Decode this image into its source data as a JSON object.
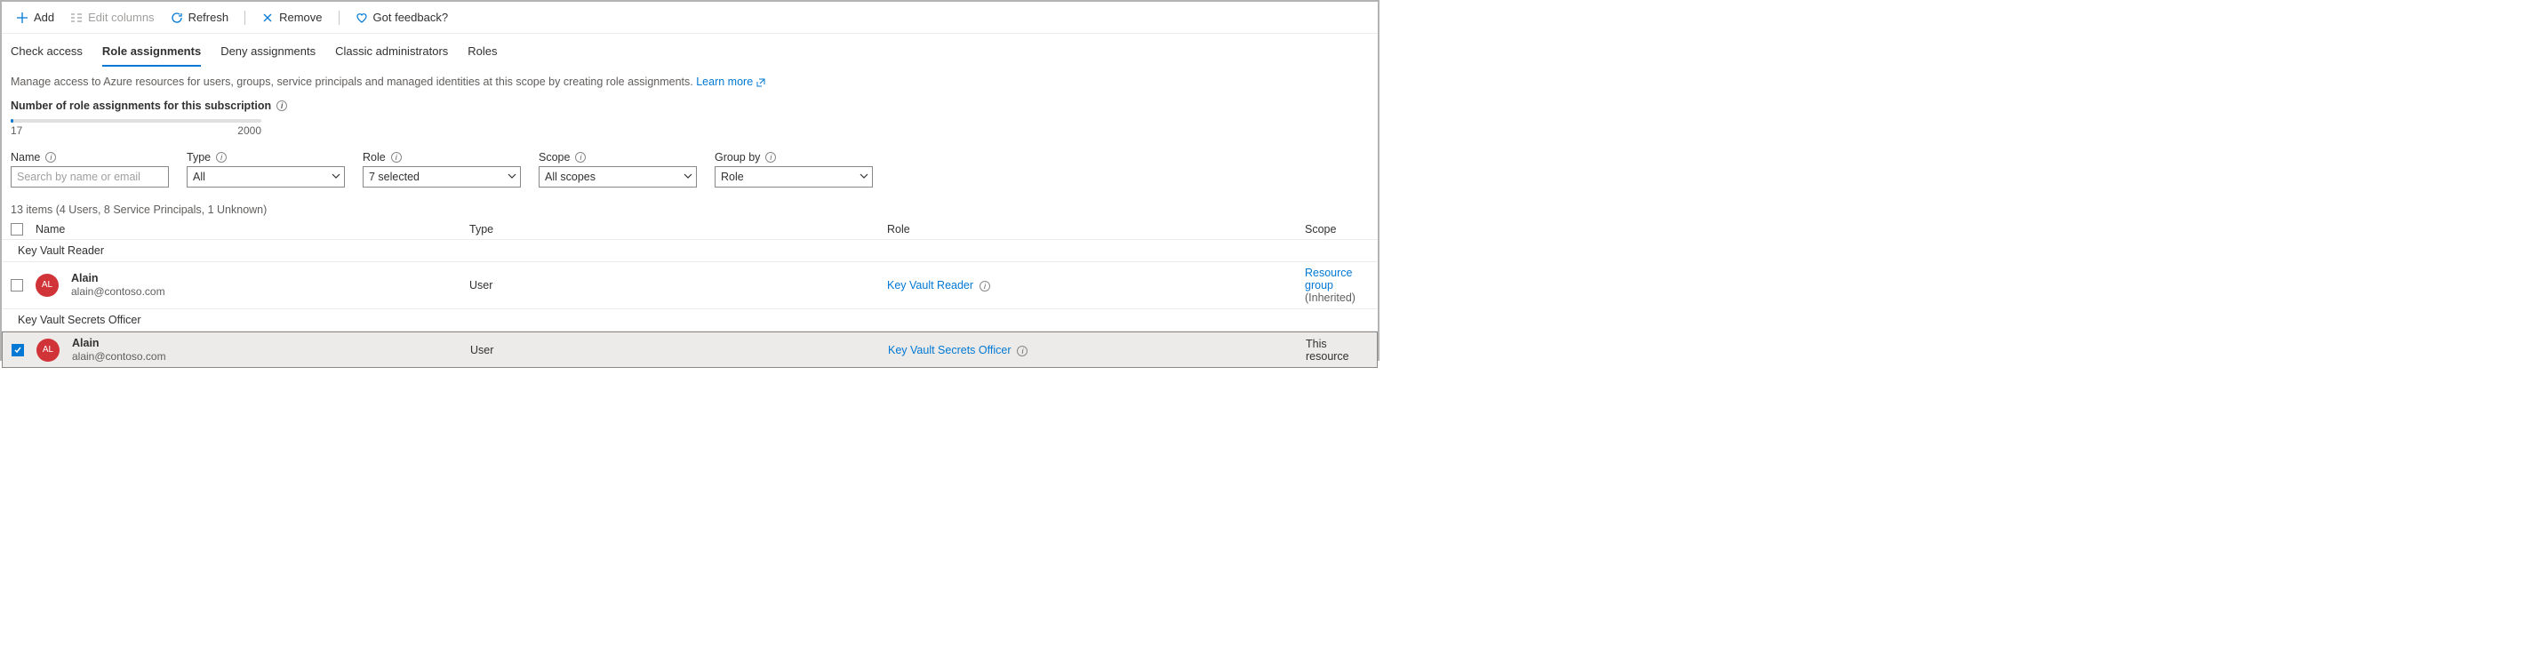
{
  "toolbar": {
    "add": "Add",
    "edit_columns": "Edit columns",
    "refresh": "Refresh",
    "remove": "Remove",
    "feedback": "Got feedback?"
  },
  "tabs": {
    "check_access": "Check access",
    "role_assignments": "Role assignments",
    "deny_assignments": "Deny assignments",
    "classic_admins": "Classic administrators",
    "roles": "Roles"
  },
  "description": {
    "text": "Manage access to Azure resources for users, groups, service principals and managed identities at this scope by creating role assignments. ",
    "learn_more": "Learn more"
  },
  "quota": {
    "title": "Number of role assignments for this subscription",
    "current": "17",
    "max": "2000"
  },
  "filters": {
    "name_label": "Name",
    "name_placeholder": "Search by name or email",
    "type_label": "Type",
    "type_value": "All",
    "role_label": "Role",
    "role_value": "7 selected",
    "scope_label": "Scope",
    "scope_value": "All scopes",
    "groupby_label": "Group by",
    "groupby_value": "Role"
  },
  "summary": "13 items (4 Users, 8 Service Principals, 1 Unknown)",
  "columns": {
    "name": "Name",
    "type": "Type",
    "role": "Role",
    "scope": "Scope"
  },
  "groups": [
    {
      "label": "Key Vault Reader",
      "rows": [
        {
          "checked": false,
          "avatar": "AL",
          "name": "Alain",
          "email": "alain@contoso.com",
          "type": "User",
          "role": "Key Vault Reader",
          "scope_link": "Resource group",
          "scope_suffix": "(Inherited)"
        }
      ]
    },
    {
      "label": "Key Vault Secrets Officer",
      "rows": [
        {
          "checked": true,
          "avatar": "AL",
          "name": "Alain",
          "email": "alain@contoso.com",
          "type": "User",
          "role": "Key Vault Secrets Officer",
          "scope_text": "This resource"
        }
      ]
    }
  ]
}
